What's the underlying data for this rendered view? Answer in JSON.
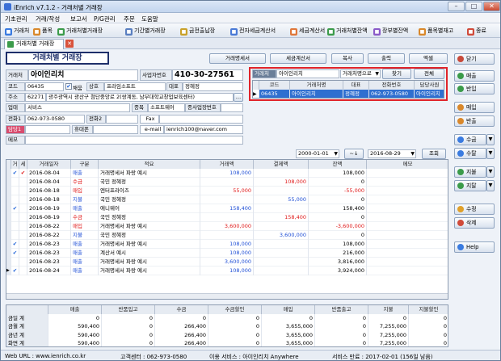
{
  "window": {
    "title": "iEnrich v7.1.2 - 거래처별 거래장"
  },
  "menu": [
    "기초관리",
    "거래/작성",
    "보고서",
    "P/G관리",
    "주문",
    "도움말"
  ],
  "toolbar": [
    "거래처",
    "품목",
    "거래처별거래장",
    "기간별거래장",
    "금전출납장",
    "전자세금계산서",
    "세금계산서",
    "거래처별잔액",
    "장부별잔액",
    "품목별재고",
    "종료"
  ],
  "tab": {
    "label": "거래처별 거래장"
  },
  "header": {
    "title": "거래처별 거래장",
    "btn_statement": "거래명세서",
    "btn_tax": "세금계산서",
    "btn_copy": "복사",
    "btn_print": "출력",
    "btn_excel": "엑셀",
    "btn_close": "닫기"
  },
  "client": {
    "name_label": "거래처",
    "name": "아이인리치",
    "bizno_label": "사업자번호",
    "bizno": "410-30-27561",
    "code_label": "코드",
    "code": "06435",
    "use_label": "채움",
    "trade_label": "상호",
    "trade": "프라임소프트",
    "ceo_label": "대표",
    "ceo": "정혜정",
    "addr_label": "주소",
    "zip": "62271",
    "addr": "광주광역시 광산구 첨단중앙로 2(쌍계동, 남부대학교창업보육센터)",
    "type_label": "업태",
    "type": "서비스",
    "item_label": "종목",
    "item": "소프트웨어",
    "emp_label": "종사업장번호",
    "tel1_label": "전화1",
    "tel1": "062-973-0580",
    "tel2_label": "전화2",
    "fax_label": "Fax",
    "manager_label": "담당1",
    "mobile_label": "휴대폰",
    "email_label": "e-mail",
    "email": "ienrich100@naver.com",
    "memo_label": "메모"
  },
  "search": {
    "label": "거래처",
    "value": "아이인리치",
    "mode": "거래처명으로",
    "find": "찾기",
    "all": "전체",
    "columns": [
      "코드",
      "거래처명",
      "대표",
      "전화번호",
      "담당사원"
    ],
    "rows": [
      {
        "code": "06435",
        "name": "아이인리치",
        "ceo": "정혜정",
        "tel": "062-973-0580",
        "staff": "아이인리치"
      }
    ]
  },
  "period": {
    "from": "2000-01-01",
    "to": "2016-08-29",
    "query": "조회"
  },
  "side_buttons": [
    "매출",
    "반입",
    "매입",
    "반출",
    "수금",
    "수탈",
    "지불",
    "지탈",
    "수정",
    "삭제",
    "Help"
  ],
  "ledger": {
    "columns": [
      "거",
      "세",
      "거래일자",
      "구분",
      "적요",
      "거래액",
      "결제액",
      "잔액",
      "메모"
    ],
    "rows": [
      {
        "c1": "✔",
        "c2": "✔",
        "date": "2016-08-04",
        "kind": "매출",
        "desc": "거래명세서 파랑 예시",
        "amt": "108,000",
        "pay": "",
        "bal": "108,000"
      },
      {
        "c1": "",
        "c2": "",
        "date": "2016-08-04",
        "kind": "수금",
        "desc": "국민 정혜정",
        "amt": "",
        "pay": "108,000",
        "bal": "0"
      },
      {
        "c1": "",
        "c2": "",
        "date": "2016-08-18",
        "kind": "매입",
        "desc": "엔터프라이즈",
        "amt": "55,000",
        "pay": "",
        "bal": "-55,000"
      },
      {
        "c1": "",
        "c2": "",
        "date": "2016-08-18",
        "kind": "지불",
        "desc": "국민 정혜정",
        "amt": "",
        "pay": "55,000",
        "bal": "0"
      },
      {
        "c1": "✔",
        "c2": "",
        "date": "2016-08-19",
        "kind": "매출",
        "desc": "애니웨어",
        "amt": "158,400",
        "pay": "",
        "bal": "158,400"
      },
      {
        "c1": "",
        "c2": "",
        "date": "2016-08-19",
        "kind": "수금",
        "desc": "국민 정혜정",
        "amt": "",
        "pay": "158,400",
        "bal": "0"
      },
      {
        "c1": "",
        "c2": "",
        "date": "2016-08-22",
        "kind": "매입",
        "desc": "거래명세서 파랑 예시",
        "amt": "3,600,000",
        "pay": "",
        "bal": "-3,600,000"
      },
      {
        "c1": "",
        "c2": "",
        "date": "2016-08-22",
        "kind": "지불",
        "desc": "국민 정혜정",
        "amt": "",
        "pay": "3,600,000",
        "bal": "0"
      },
      {
        "c1": "✔",
        "c2": "",
        "date": "2016-08-23",
        "kind": "매출",
        "desc": "거래명세서 파랑 예시",
        "amt": "108,000",
        "pay": "",
        "bal": "108,000"
      },
      {
        "c1": "✔",
        "c2": "",
        "date": "2016-08-23",
        "kind": "매출",
        "desc": "계산서 예시",
        "amt": "108,000",
        "pay": "",
        "bal": "216,000"
      },
      {
        "c1": "",
        "c2": "",
        "date": "2016-08-23",
        "kind": "매출",
        "desc": "거래명세서 파랑 예시",
        "amt": "3,600,000",
        "pay": "",
        "bal": "3,816,000"
      },
      {
        "c1": "✔",
        "c2": "",
        "date": "2016-08-24",
        "kind": "매출",
        "desc": "거래명세서 파랑 예시",
        "amt": "108,000",
        "pay": "",
        "bal": "3,924,000"
      }
    ]
  },
  "summary": {
    "columns": [
      "",
      "매출",
      "반품입고",
      "수금",
      "수금할인",
      "매입",
      "반품출고",
      "지불",
      "지불할인"
    ],
    "rows": [
      [
        "금일 계",
        "0",
        "0",
        "0",
        "0",
        "0",
        "0",
        "0",
        "0"
      ],
      [
        "금월 계",
        "590,400",
        "0",
        "266,400",
        "0",
        "3,655,000",
        "0",
        "7,255,000",
        "0"
      ],
      [
        "금년 계",
        "590,400",
        "0",
        "266,400",
        "0",
        "3,655,000",
        "0",
        "7,255,000",
        "0"
      ],
      [
        "화면 계",
        "590,400",
        "0",
        "266,400",
        "0",
        "3,655,000",
        "0",
        "7,255,000",
        "0"
      ]
    ]
  },
  "status": {
    "web": "Web URL : www.ienrich.co.kr",
    "center": "고객센터 : 062-973-0580",
    "service": "이용 서비스 : 아이인리치 Anywhere",
    "expire": "서비스 만료 : 2017-02-01 (156일 남음)"
  },
  "colors": {
    "accent": "#1f4fd6",
    "highlight": "#e01a1a",
    "selected_row": "#2f6fd0"
  }
}
